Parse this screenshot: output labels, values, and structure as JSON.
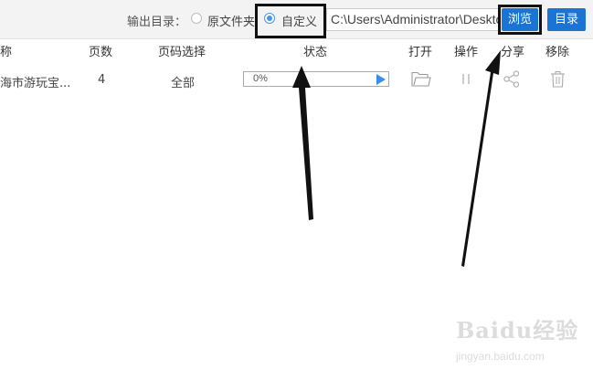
{
  "toolbar": {
    "output_label": "输出目录：",
    "option_original": "原文件夹",
    "option_custom": "自定义",
    "selected": "自定义",
    "path_value": "C:\\Users\\Administrator\\Desktop",
    "browse_label": "浏览",
    "dir_label": "目录"
  },
  "table": {
    "columns": [
      "称",
      "页数",
      "页码选择",
      "状态",
      "打开",
      "操作",
      "分享",
      "移除"
    ],
    "rows": [
      {
        "name": "海市游玩宝...",
        "pages": "4",
        "page_selection": "全部",
        "progress_text": "0%",
        "progress": 0
      }
    ]
  },
  "watermark": {
    "brand": "Baidu经验",
    "url": "jingyan.baidu.com"
  },
  "colors": {
    "accent": "#1b73d4",
    "radio_selected": "#4b95e6",
    "annotation": "#111111"
  },
  "icons": [
    "folder-icon",
    "pause-icon",
    "share-icon",
    "trash-icon",
    "play-icon",
    "annotation-arrow-icon"
  ]
}
